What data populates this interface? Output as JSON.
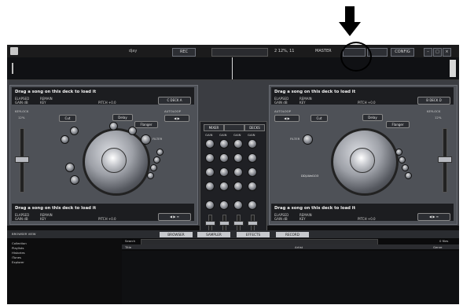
{
  "app": {
    "title": "djay",
    "master_label": "MASTER",
    "screen_label": "2 12%, 11",
    "buttons": {
      "record": "REC",
      "rmx": "",
      "save": "",
      "config": "CONFIG"
    }
  },
  "decks": {
    "left": {
      "message": "Drag a song on this deck to load it",
      "elapsed_label": "ELAPSED",
      "remain_label": "REMAIN",
      "gain_label": "GAIN dB",
      "key_label": "KEY",
      "pitch_label": "PITCH +0.0",
      "deck_switch": "C DECK A",
      "keylock_label": "KEYLOCK",
      "keylock_value": "12%",
      "fx_label": "Delay",
      "fx_tab_left": "Cut",
      "fx_tab_right": "Flanger",
      "auto_label": "AUTOLOOP",
      "filter_label": "FILTER",
      "bottom_message": "Drag a song on this deck to load it",
      "bottom_elapsed": "ELAPSED",
      "bottom_remain": "REMAIN",
      "bottom_gain": "GAIN dB",
      "bottom_key": "KEY",
      "bottom_pitch": "PITCH +0.0"
    },
    "right": {
      "message": "Drag a song on this deck to load it",
      "elapsed_label": "ELAPSED",
      "remain_label": "REMAIN",
      "gain_label": "GAIN dB",
      "key_label": "KEY",
      "pitch_label": "PITCH +0.0",
      "deck_switch": "B DECK D",
      "keylock_label": "KEYLOCK",
      "keylock_value": "12%",
      "fx_label": "Delay",
      "fx_tab_left": "Cut",
      "fx_tab_right": "Flanger",
      "auto_label": "AUTOLOOP",
      "filter_label": "FILTER",
      "device_label": "DDJ-WeGO3",
      "bottom_message": "Drag a song on this deck to load it",
      "bottom_elapsed": "ELAPSED",
      "bottom_remain": "REMAIN",
      "bottom_gain": "GAIN dB",
      "bottom_key": "KEY",
      "bottom_pitch": "PITCH +0.0"
    }
  },
  "mixer": {
    "tabs": [
      "MIXER",
      "",
      "DECKS"
    ],
    "labels": [
      "GAIN",
      "GAIN",
      "GAIN",
      "GAIN"
    ]
  },
  "browser": {
    "tabs": [
      "BROWSER",
      "SAMPLER",
      "EFFECTS",
      "RECORD"
    ],
    "left_label": "BROWSER VIEW",
    "search_label": "Search",
    "columns": [
      "Title",
      "Artist",
      "Genre"
    ],
    "count_label": "0 files",
    "tree": [
      "Collection",
      "Playlists",
      "Histories",
      "iTunes",
      "Explorer"
    ]
  }
}
